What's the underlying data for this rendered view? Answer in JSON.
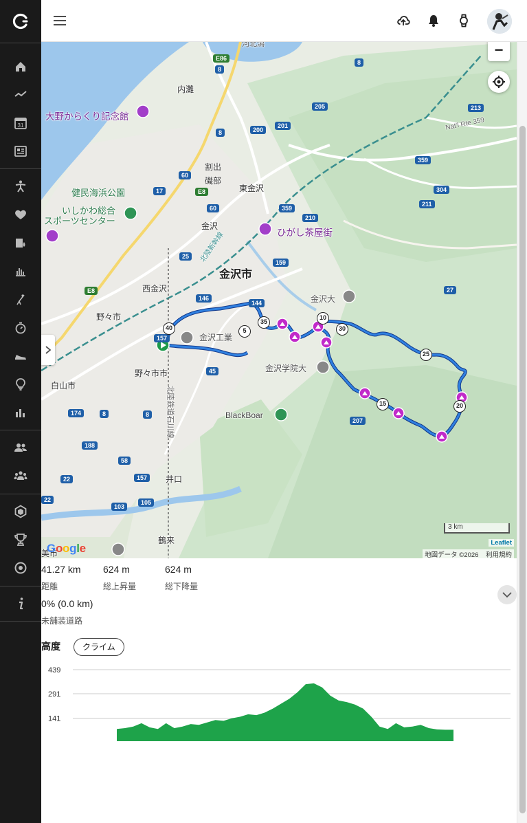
{
  "header": {
    "menu_icon": "hamburger-icon",
    "upload_icon": "cloud-upload-icon",
    "notifications_icon": "bell-icon",
    "device_icon": "watch-icon"
  },
  "sidebar": {
    "items": [
      "home-icon",
      "activity-pulse-icon",
      "calendar-icon",
      "news-feed-icon",
      "running-person-icon",
      "heart-icon",
      "tracking-icon",
      "reports-chart-icon",
      "golf-icon",
      "stopwatch-icon",
      "shoe-icon",
      "lightbulb-icon",
      "statistics-icon",
      "connections-icon",
      "groups-icon",
      "badges-icon",
      "trophy-icon",
      "target-icon",
      "info-icon"
    ],
    "calendar_day": "31"
  },
  "map": {
    "labels": {
      "kahokugata": "河北潟",
      "ono_karakuri": "大野からくり記念館",
      "uchinada": "内灘",
      "warude": "割出",
      "isobe": "磯部",
      "higashi_kanazawa": "東金沢",
      "kenmin_kaihin": "健民海浜公園",
      "ishikawa_sports1": "いしかわ総合",
      "ishikawa_sports2": "スポーツセンター",
      "kanazawa_station": "金沢",
      "higashi_chaya": "ひがし茶屋街",
      "kanazawa_city": "金沢市",
      "nishi_kanazawa": "西金沢",
      "kanazawa_univ": "金沢大",
      "nonoichi": "野々市",
      "kanazawa_kogyo": "金沢工業",
      "nonoichi_city": "野々市市",
      "kanazawa_gakuin": "金沢学院大",
      "hakusan_city": "白山市",
      "blackboar": "BlackBoar",
      "iguchi": "井口",
      "tsurugi": "鶴来",
      "city_fragment": "美市",
      "hokuriku_shinkansen": "北陸新幹線",
      "hokuriku_railway": "北陸鉄道石川線",
      "national_route": "Nat'l Rte 359"
    },
    "road_numbers": [
      "E86",
      "8",
      "8",
      "205",
      "213",
      "200",
      "201",
      "8",
      "359",
      "60",
      "17",
      "E8",
      "304",
      "211",
      "60",
      "359",
      "210",
      "25",
      "159",
      "E8",
      "27",
      "146",
      "144",
      "157",
      "45",
      "8",
      "207",
      "174",
      "8",
      "22",
      "188",
      "58",
      "22",
      "157",
      "103",
      "105"
    ],
    "distance_markers": [
      "5",
      "10",
      "15",
      "20",
      "25",
      "30",
      "35",
      "40"
    ],
    "zoom_out": "−",
    "scale": "3 km",
    "leaflet": "Leaflet",
    "map_data": "地図データ ©2026",
    "terms": "利用規約",
    "google_letters": [
      "G",
      "o",
      "o",
      "g",
      "l",
      "e"
    ]
  },
  "stats": {
    "distance_value": "41.27 km",
    "distance_label": "距離",
    "ascent_value": "624 m",
    "ascent_label": "総上昇量",
    "descent_value": "624 m",
    "descent_label": "総下降量",
    "unpaved_value": "0% (0.0 km)",
    "unpaved_label": "未舗装道路"
  },
  "elevation": {
    "title": "高度",
    "climb_button": "クライム"
  },
  "chart_data": {
    "type": "area",
    "title": "",
    "xlabel": "",
    "ylabel": "",
    "y_ticks": [
      "439",
      "291",
      "141"
    ],
    "ylim": [
      0,
      439
    ],
    "x": [
      0,
      1,
      2,
      3,
      4,
      5,
      6,
      7,
      8,
      9,
      10,
      11,
      12,
      13,
      14,
      15,
      16,
      17,
      18,
      19,
      20,
      21,
      22,
      23,
      24,
      25,
      26,
      27,
      28,
      29,
      30,
      31,
      32,
      33,
      34,
      35,
      36,
      37,
      38,
      39,
      40,
      41
    ],
    "values": [
      75,
      80,
      90,
      110,
      85,
      75,
      110,
      80,
      90,
      105,
      100,
      115,
      130,
      125,
      140,
      150,
      165,
      160,
      175,
      200,
      230,
      260,
      300,
      350,
      355,
      330,
      280,
      250,
      240,
      225,
      200,
      150,
      90,
      75,
      110,
      85,
      90,
      100,
      80,
      72,
      70,
      70
    ],
    "series_color": "#1ea34a"
  }
}
